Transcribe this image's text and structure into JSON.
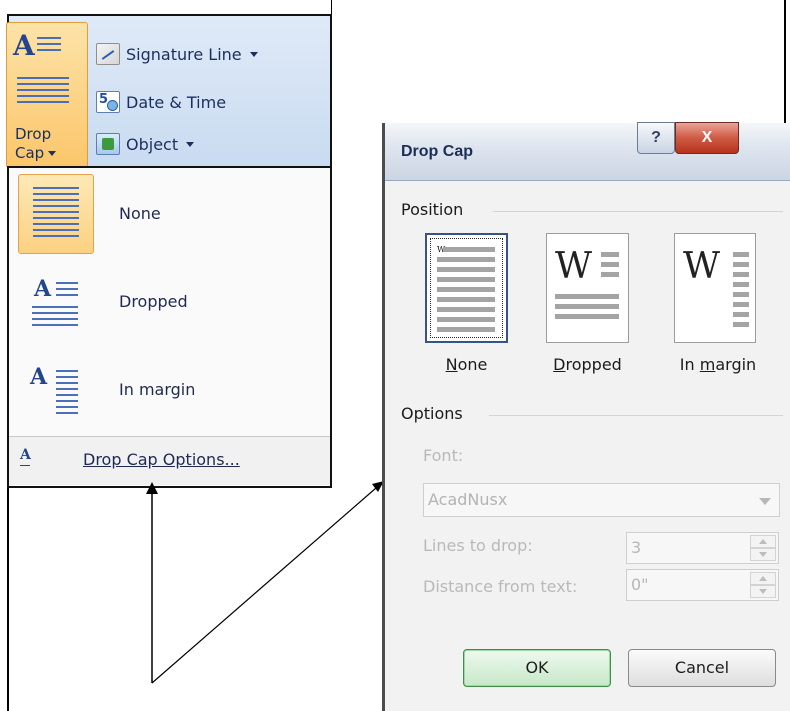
{
  "ribbon": {
    "drop_cap_line1": "Drop",
    "drop_cap_line2": "Cap",
    "signature_line": "Signature Line",
    "date_time": "Date & Time",
    "object": "Object"
  },
  "menu": {
    "items": [
      {
        "label": "None"
      },
      {
        "label": "Dropped"
      },
      {
        "label": "In margin"
      }
    ],
    "options_label": "Drop Cap Options..."
  },
  "dialog": {
    "title": "Drop Cap",
    "help_label": "?",
    "close_label": "X",
    "position_group": "Position",
    "positions": [
      {
        "label": "None",
        "accel": "N",
        "rest": "one",
        "selected": true
      },
      {
        "label": "Dropped",
        "accel": "D",
        "rest": "ropped",
        "selected": false
      },
      {
        "label": "In margin",
        "pre": "In ",
        "accel": "m",
        "rest": "argin",
        "selected": false
      }
    ],
    "options_group": "Options",
    "font_label": "Font:",
    "font_value": "AcadNusx",
    "lines_label": "Lines to drop:",
    "lines_value": "3",
    "distance_label": "Distance from text:",
    "distance_value": "0\"",
    "ok_label": "OK",
    "cancel_label": "Cancel"
  },
  "colors": {
    "selected_fill": "#fbd181",
    "selected_border": "#e7a04b",
    "menu_text": "#1f2a52",
    "disabled_text": "#b9b9b9"
  }
}
